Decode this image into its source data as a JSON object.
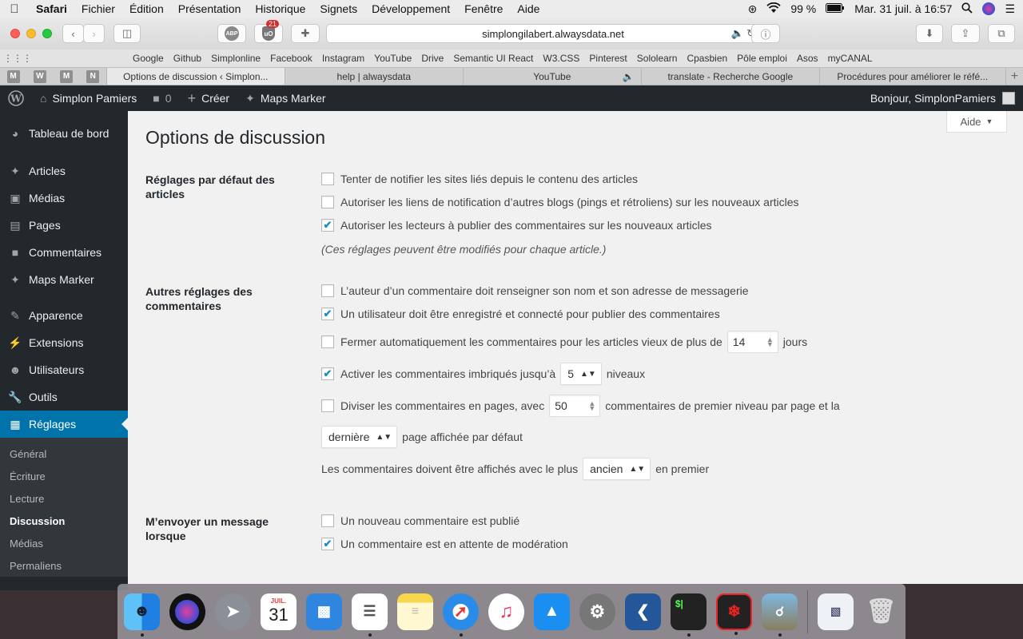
{
  "menubar": {
    "app": "Safari",
    "items": [
      "Fichier",
      "Édition",
      "Présentation",
      "Historique",
      "Signets",
      "Développement",
      "Fenêtre",
      "Aide"
    ],
    "battery": "99 %",
    "datetime": "Mar. 31 juil. à 16:57"
  },
  "toolbar": {
    "url": "simplongilabert.alwaysdata.net",
    "abp_label": "ABP",
    "ublock_label": "uO",
    "ublock_badge": "21"
  },
  "bookmarks": [
    "Google",
    "Github",
    "Simplonline",
    "Facebook",
    "Instagram",
    "YouTube",
    "Drive",
    "Semantic UI React",
    "W3.CSS",
    "Pinterest",
    "Sololearn",
    "Cpasbien",
    "Pôle emploi",
    "Asos",
    "myCANAL"
  ],
  "tabs": {
    "pinned": [
      "M",
      "W",
      "M",
      "N"
    ],
    "items": [
      {
        "label": "Options de discussion ‹ Simplon..."
      },
      {
        "label": "help | alwaysdata"
      },
      {
        "label": "YouTube"
      },
      {
        "label": "translate - Recherche Google"
      },
      {
        "label": "Procédures pour améliorer le réfé..."
      }
    ]
  },
  "wpbar": {
    "site": "Simplon Pamiers",
    "comments_count": "0",
    "create": "Créer",
    "maps": "Maps Marker",
    "greeting": "Bonjour, SimplonPamiers"
  },
  "sidebar": {
    "dashboard": "Tableau de bord",
    "items": [
      "Articles",
      "Médias",
      "Pages",
      "Commentaires",
      "Maps Marker"
    ],
    "items2": [
      "Apparence",
      "Extensions",
      "Utilisateurs",
      "Outils"
    ],
    "active": "Réglages",
    "submenu": [
      "Général",
      "Écriture",
      "Lecture",
      "Discussion",
      "Médias",
      "Permaliens"
    ],
    "current_sub": "Discussion"
  },
  "content": {
    "help": "Aide",
    "title": "Options de discussion",
    "section1": {
      "label": "Réglages par défaut des articles",
      "opt1": "Tenter de notifier les sites liés depuis le contenu des articles",
      "opt2": "Autoriser les liens de notification d’autres blogs (pings et rétroliens) sur les nouveaux articles",
      "opt3": "Autoriser les lecteurs à publier des commentaires sur les nouveaux articles",
      "note": "(Ces réglages peuvent être modifiés pour chaque article.)"
    },
    "section2": {
      "label": "Autres réglages des commentaires",
      "opt1": "L’auteur d’un commentaire doit renseigner son nom et son adresse de messagerie",
      "opt2": "Un utilisateur doit être enregistré et connecté pour publier des commentaires",
      "opt3_before": "Fermer automatiquement les commentaires pour les articles vieux de plus de",
      "opt3_value": "14",
      "opt3_after": "jours",
      "opt4_before": "Activer les commentaires imbriqués jusqu’à",
      "opt4_value": "5",
      "opt4_after": "niveaux",
      "opt5_before": "Diviser les commentaires en pages, avec",
      "opt5_value": "50",
      "opt5_after": "commentaires de premier niveau par page et la",
      "opt6_select": "dernière",
      "opt6_after": "page affichée par défaut",
      "opt7_before": "Les commentaires doivent être affichés avec le plus",
      "opt7_select": "ancien",
      "opt7_after": "en premier"
    },
    "section3": {
      "label": "M’envoyer un message lorsque",
      "opt1": "Un nouveau commentaire est publié",
      "opt2": "Un commentaire est en attente de modération"
    },
    "checks": {
      "s1o1": false,
      "s1o2": false,
      "s1o3": true,
      "s2o1": false,
      "s2o2": true,
      "s2o3": false,
      "s2o4": true,
      "s2o5": false,
      "s3o1": false,
      "s3o2": true
    }
  },
  "dock": {
    "calendar_month": "JUIL.",
    "calendar_day": "31"
  }
}
